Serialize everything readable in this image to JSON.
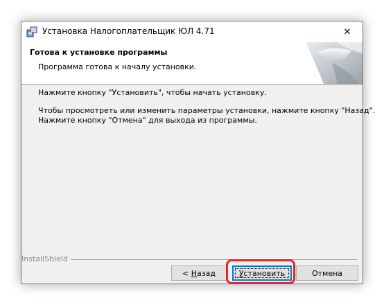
{
  "window": {
    "title": "Установка Налогоплательщик ЮЛ 4.71",
    "close_glyph": "✕"
  },
  "header": {
    "title": "Готова к установке программы",
    "subtitle": "Программа готова к началу установки."
  },
  "body": {
    "line1": "Нажмите кнопку \"Установить\", чтобы начать установку.",
    "line2": "Чтобы просмотреть или изменить параметры установки, нажмите кнопку \"Назад\".",
    "line3": "Нажмите кнопку \"Отмена\" для выхода из программы."
  },
  "footer": {
    "brand": "InstallShield"
  },
  "buttons": {
    "back_prefix": "< ",
    "back_accel": "Н",
    "back_rest": "азад",
    "install_accel": "У",
    "install_rest": "становить",
    "cancel": "Отмена"
  },
  "colors": {
    "focus_border": "#0078d7",
    "highlight": "#e52626"
  }
}
